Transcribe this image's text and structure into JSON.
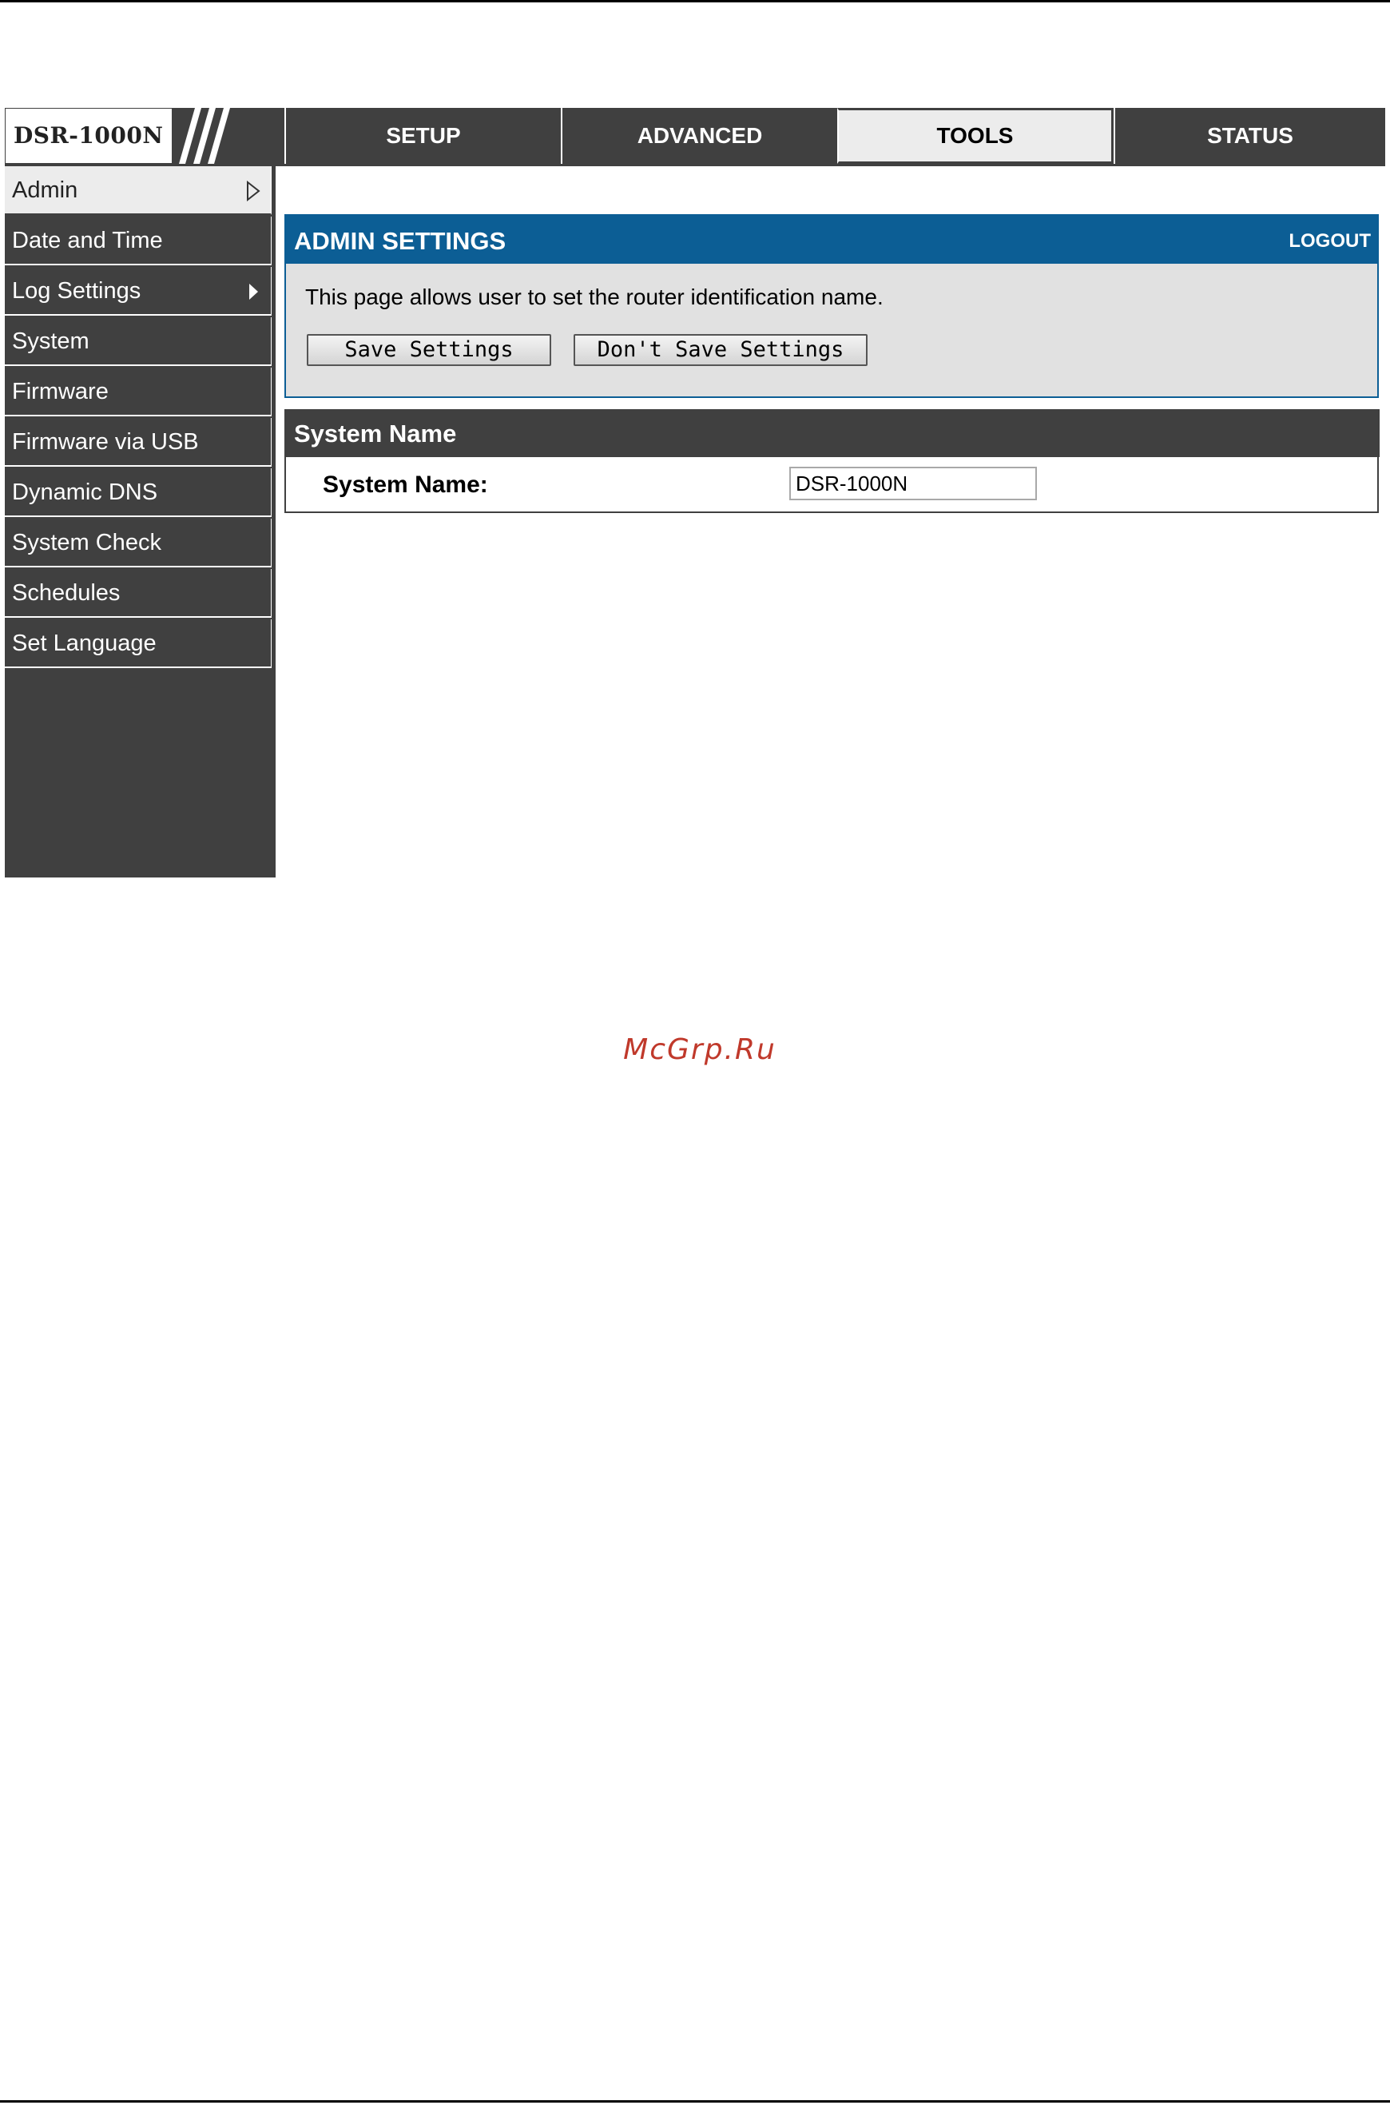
{
  "brand": {
    "model": "DSR-1000N"
  },
  "topnav": {
    "tabs": [
      {
        "label": "SETUP",
        "active": false
      },
      {
        "label": "ADVANCED",
        "active": false
      },
      {
        "label": "TOOLS",
        "active": true
      },
      {
        "label": "STATUS",
        "active": false
      }
    ]
  },
  "sidebar": {
    "items": [
      {
        "label": "Admin",
        "active": true,
        "icon": "triangle-right-outline-icon"
      },
      {
        "label": "Date and Time",
        "active": false
      },
      {
        "label": "Log Settings",
        "active": false,
        "icon": "triangle-right-filled-icon"
      },
      {
        "label": "System",
        "active": false
      },
      {
        "label": "Firmware",
        "active": false
      },
      {
        "label": "Firmware via USB",
        "active": false
      },
      {
        "label": "Dynamic DNS",
        "active": false
      },
      {
        "label": "System Check",
        "active": false
      },
      {
        "label": "Schedules",
        "active": false
      },
      {
        "label": "Set Language",
        "active": false
      }
    ]
  },
  "admin_panel": {
    "title": "ADMIN SETTINGS",
    "logout_label": "LOGOUT",
    "description": "This page allows user to set the router identification name.",
    "save_label": "Save Settings",
    "dont_save_label": "Don't Save Settings"
  },
  "system_name_section": {
    "title": "System Name",
    "field_label": "System Name:",
    "field_value": "DSR-1000N"
  },
  "watermark": "McGrp.Ru",
  "colors": {
    "header_blue": "#0c5e95",
    "nav_dark": "#404040",
    "panel_bg": "#e1e1e1",
    "watermark_red": "#c0392b"
  }
}
